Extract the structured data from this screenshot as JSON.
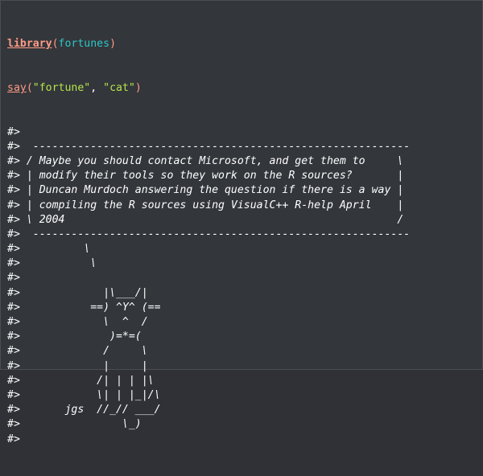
{
  "code": {
    "line1": {
      "fn": "library",
      "open": "(",
      "arg": "fortunes",
      "close": ")"
    },
    "line2": {
      "fn": "say",
      "open": "(",
      "arg1": "\"fortune\"",
      "sep": ", ",
      "arg2": "\"cat\"",
      "close": ")"
    }
  },
  "output": {
    "prompt": "#>",
    "lines": [
      "",
      "  -----------------------------------------------------------",
      " / Maybe you should contact Microsoft, and get them to     \\",
      " | modify their tools so they work on the R sources?       |",
      " | Duncan Murdoch answering the question if there is a way |",
      " | compiling the R sources using VisualC++ R-help April    |",
      " \\ 2004                                                    /",
      "  -----------------------------------------------------------",
      "          \\",
      "           \\",
      "",
      "             |\\___/|",
      "           ==) ^Y^ (==",
      "             \\  ^  /",
      "              )=*=(",
      "             /     \\",
      "             |     |",
      "            /| | | |\\",
      "            \\| | |_|/\\",
      "       jgs  //_// ___/",
      "                \\_)",
      ""
    ]
  }
}
